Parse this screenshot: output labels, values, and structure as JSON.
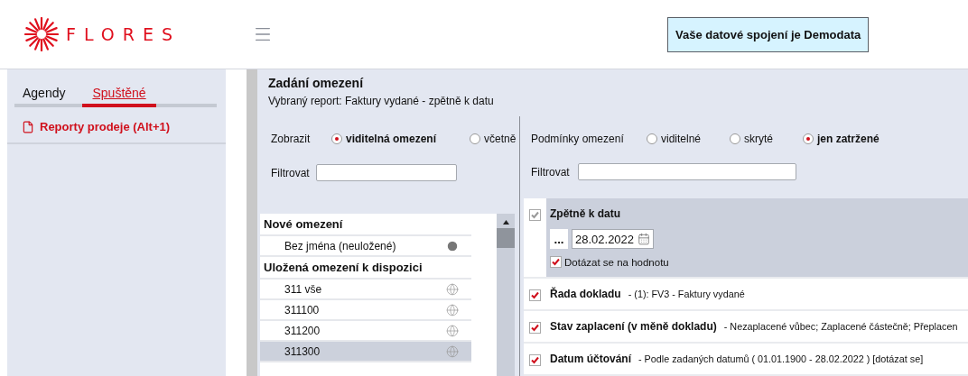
{
  "logo": {
    "text": "FLORES"
  },
  "connection_banner": "Vaše datové spojení je Demodata",
  "sidebar": {
    "tabs": [
      {
        "label": "Agendy",
        "selected": false
      },
      {
        "label": "Spuštěné",
        "selected": true
      }
    ],
    "items": [
      {
        "label": "Reporty prodeje (Alt+1)"
      }
    ]
  },
  "panel": {
    "title": "Zadání omezení",
    "subtitle": "Vybraný report: Faktury vydané - zpětně k datu"
  },
  "left_pane": {
    "show_label": "Zobrazit",
    "show_options": [
      {
        "label": "viditelná omezení",
        "selected": true
      },
      {
        "label": "včetně",
        "selected": false
      }
    ],
    "filter_label": "Filtrovat",
    "groups": [
      {
        "title": "Nové omezení",
        "items": [
          {
            "label": "Bez jména (neuložené)",
            "kind": "user",
            "selected": false
          }
        ]
      },
      {
        "title": "Uložená omezení k dispozici",
        "items": [
          {
            "label": "311 vše",
            "kind": "global",
            "selected": false
          },
          {
            "label": "311100",
            "kind": "global",
            "selected": false
          },
          {
            "label": "311200",
            "kind": "global",
            "selected": false
          },
          {
            "label": "311300",
            "kind": "global",
            "selected": true
          }
        ]
      }
    ]
  },
  "right_pane": {
    "conditions_label": "Podmínky omezení",
    "condition_options": [
      {
        "label": "viditelné",
        "selected": false
      },
      {
        "label": "skryté",
        "selected": false
      },
      {
        "label": "jen zatržené",
        "selected": true
      }
    ],
    "filter_label": "Filtrovat",
    "conditions": [
      {
        "kind": "date",
        "name": "Zpětně k datu",
        "checked": true,
        "disabled": true,
        "selected": true,
        "button": "...",
        "date": "28.02.2022",
        "ask": {
          "label": "Dotázat se na hodnotu",
          "checked": true
        }
      },
      {
        "kind": "summary",
        "name": "Řada dokladu",
        "detail": "- (1): FV3 - Faktury vydané",
        "checked": true,
        "disabled": false,
        "selected": false
      },
      {
        "kind": "summary",
        "name": "Stav zaplacení (v měně dokladu)",
        "detail": "- Nezaplacené vůbec; Zaplacené částečně; Přeplacen",
        "checked": true,
        "disabled": false,
        "selected": false
      },
      {
        "kind": "summary",
        "name": "Datum účtování",
        "detail": "- Podle zadaných datumů ( 01.01.1900 - 28.02.2022 ) [dotázat se]",
        "checked": true,
        "disabled": false,
        "selected": false
      }
    ]
  }
}
